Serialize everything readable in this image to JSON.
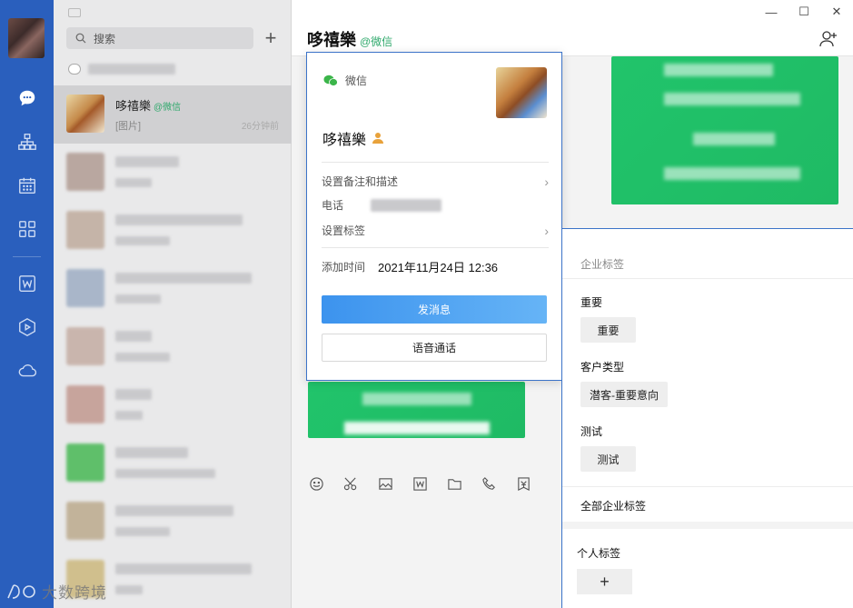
{
  "sidebar": {
    "nav_icons": [
      "chat-icon",
      "org-icon",
      "calendar-icon",
      "apps-icon",
      "word-icon",
      "play-icon",
      "cloud-icon"
    ]
  },
  "watermark": "大数跨境",
  "search": {
    "placeholder": "搜索"
  },
  "chat_list": {
    "active": {
      "name": "哆禧樂",
      "tag": "@微信",
      "snippet": "[图片]",
      "time": "26分钟前"
    }
  },
  "main": {
    "title": "哆禧樂",
    "title_tag": "@微信"
  },
  "window_controls": {
    "minimize": "—",
    "maximize": "☐",
    "close": "✕"
  },
  "profile": {
    "source": "微信",
    "name": "哆禧樂",
    "rows": {
      "remark": "设置备注和描述",
      "phone": "电话",
      "tag": "设置标签",
      "added_label": "添加时间",
      "added_value": "2021年11月24日 12:36"
    },
    "send_message": "发消息",
    "voice_call": "语音通话"
  },
  "tag_panel": {
    "header": "企业标签",
    "groups": [
      {
        "title": "重要",
        "chip": "重要"
      },
      {
        "title": "客户类型",
        "chip": "潜客-重要意向"
      },
      {
        "title": "测试",
        "chip": "测试"
      }
    ],
    "all_enterprise": "全部企业标签",
    "personal": "个人标签",
    "add": "+"
  },
  "colors": {
    "rail": "#2a5fbd",
    "accent_green": "#2ea86b",
    "primary_button": "#3c93ee",
    "message_green": "#21c46b"
  }
}
